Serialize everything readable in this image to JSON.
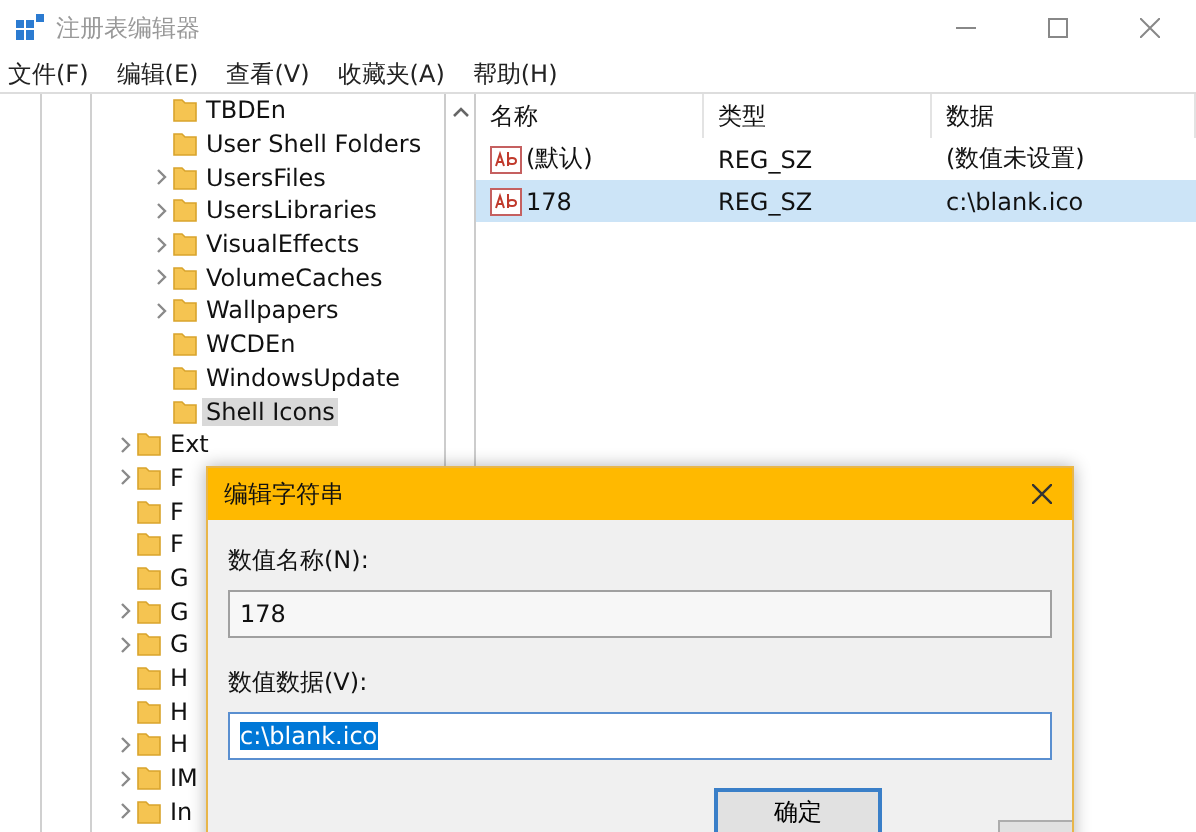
{
  "window": {
    "title": "注册表编辑器",
    "active": false
  },
  "menu": [
    "文件(F)",
    "编辑(E)",
    "查看(V)",
    "收藏夹(A)",
    "帮助(H)"
  ],
  "tree": {
    "nested": {
      "children": [
        {
          "label": "TBDEn",
          "expandable": false,
          "selected": false
        },
        {
          "label": "User Shell Folders",
          "expandable": false,
          "selected": false
        },
        {
          "label": "UsersFiles",
          "expandable": true,
          "selected": false
        },
        {
          "label": "UsersLibraries",
          "expandable": true,
          "selected": false
        },
        {
          "label": "VisualEffects",
          "expandable": true,
          "selected": false
        },
        {
          "label": "VolumeCaches",
          "expandable": true,
          "selected": false
        },
        {
          "label": "Wallpapers",
          "expandable": true,
          "selected": false
        },
        {
          "label": "WCDEn",
          "expandable": false,
          "selected": false
        },
        {
          "label": "WindowsUpdate",
          "expandable": false,
          "selected": false
        },
        {
          "label": "Shell Icons",
          "expandable": false,
          "selected": true
        }
      ]
    },
    "items": [
      {
        "label": "Ext",
        "expandable": true,
        "selected": false
      },
      {
        "label": "F",
        "expandable": true,
        "selected": false
      },
      {
        "label": "F",
        "expandable": false,
        "selected": false
      },
      {
        "label": "F",
        "expandable": false,
        "selected": false
      },
      {
        "label": "G",
        "expandable": false,
        "selected": false
      },
      {
        "label": "G",
        "expandable": true,
        "selected": false
      },
      {
        "label": "G",
        "expandable": true,
        "selected": false
      },
      {
        "label": "H",
        "expandable": false,
        "selected": false
      },
      {
        "label": "H",
        "expandable": false,
        "selected": false
      },
      {
        "label": "H",
        "expandable": true,
        "selected": false
      },
      {
        "label": "IM",
        "expandable": true,
        "selected": false
      },
      {
        "label": "In",
        "expandable": true,
        "selected": false
      }
    ]
  },
  "values": {
    "columns": [
      "名称",
      "类型",
      "数据"
    ],
    "rows": [
      {
        "name": "(默认)",
        "type": "REG_SZ",
        "data": "(数值未设置)",
        "selected": false
      },
      {
        "name": "178",
        "type": "REG_SZ",
        "data": "c:\\blank.ico",
        "selected": true
      }
    ]
  },
  "dialog": {
    "title": "编辑字符串",
    "name_label": "数值名称(N):",
    "name_value": "178",
    "data_label": "数值数据(V):",
    "data_value": "c:\\blank.ico",
    "data_text_selected": true,
    "ok_button": "确定"
  }
}
